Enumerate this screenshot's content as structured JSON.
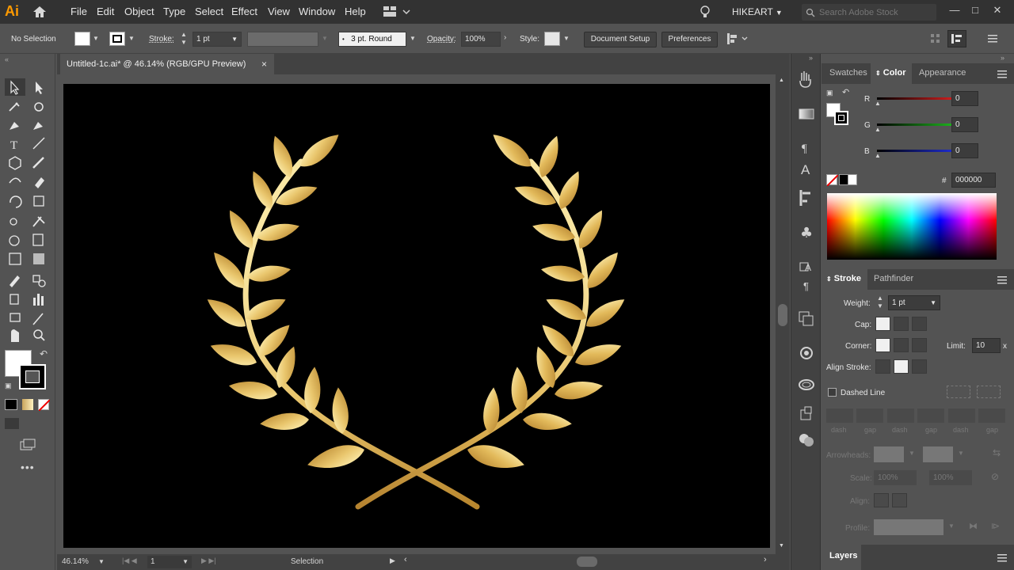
{
  "app": {
    "logo": "Ai",
    "workspace": "HIKEART",
    "search_placeholder": "Search Adobe Stock"
  },
  "menu": [
    "File",
    "Edit",
    "Object",
    "Type",
    "Select",
    "Effect",
    "View",
    "Window",
    "Help"
  ],
  "window_controls": [
    "minimize",
    "maximize",
    "close"
  ],
  "control_bar": {
    "selection": "No Selection",
    "stroke_label": "Stroke:",
    "stroke_weight": "1 pt",
    "brush": "3 pt. Round",
    "opacity_label": "Opacity:",
    "opacity_value": "100%",
    "style_label": "Style:",
    "document_setup": "Document Setup",
    "preferences": "Preferences"
  },
  "document": {
    "tab_title": "Untitled-1c.ai* @ 46.14% (RGB/GPU Preview)",
    "close": "×"
  },
  "status_bar": {
    "zoom": "46.14%",
    "artboard": "1",
    "tool": "Selection"
  },
  "color_panel": {
    "tabs": [
      "Swatches",
      "Color",
      "Appearance"
    ],
    "active_tab": "Color",
    "channels": [
      {
        "label": "R",
        "value": "0",
        "color": "#e03030"
      },
      {
        "label": "G",
        "value": "0",
        "color": "#30c030"
      },
      {
        "label": "B",
        "value": "0",
        "color": "#3040e0"
      }
    ],
    "hex_label": "#",
    "hex_value": "000000"
  },
  "stroke_panel": {
    "tabs": [
      "Stroke",
      "Pathfinder"
    ],
    "active_tab": "Stroke",
    "weight_label": "Weight:",
    "weight_value": "1 pt",
    "cap_label": "Cap:",
    "corner_label": "Corner:",
    "limit_label": "Limit:",
    "limit_value": "10",
    "limit_unit": "x",
    "align_label": "Align Stroke:",
    "dashed_label": "Dashed Line",
    "dash_labels": [
      "dash",
      "gap",
      "dash",
      "gap",
      "dash",
      "gap"
    ],
    "arrowheads_label": "Arrowheads:",
    "scale_label": "Scale:",
    "scale_values": [
      "100%",
      "100%"
    ],
    "align_arrow_label": "Align:",
    "profile_label": "Profile:"
  },
  "layers_panel": {
    "title": "Layers"
  },
  "colors": {
    "gold_light": "#fff2b0",
    "gold_mid": "#e8c46a",
    "gold_dark": "#b8862e",
    "artboard": "#000000"
  }
}
